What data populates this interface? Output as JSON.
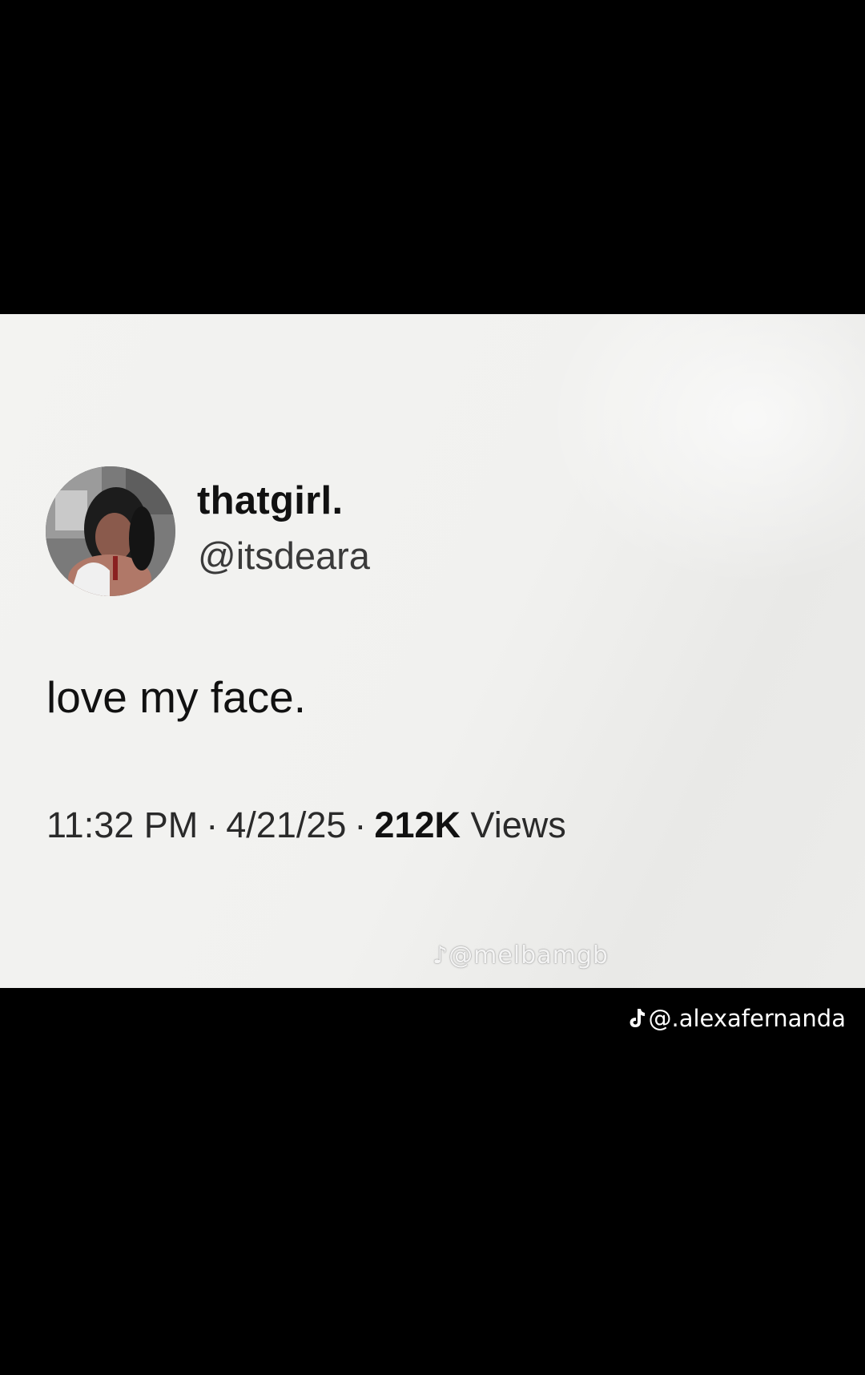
{
  "tweet": {
    "display_name": "thatgirl.",
    "handle": "@itsdeara",
    "text": "love my face.",
    "time": "11:32 PM",
    "date": "4/21/25",
    "views_count": "212K",
    "views_label": "Views",
    "separator": "·"
  },
  "watermarks": {
    "inner_handle": "@melbamgb",
    "outer_handle": "@.alexafernanda",
    "icon": "tiktok-icon"
  },
  "colors": {
    "letterbox": "#000000",
    "card_background": "#f2f2f0",
    "text_primary": "#111111"
  }
}
